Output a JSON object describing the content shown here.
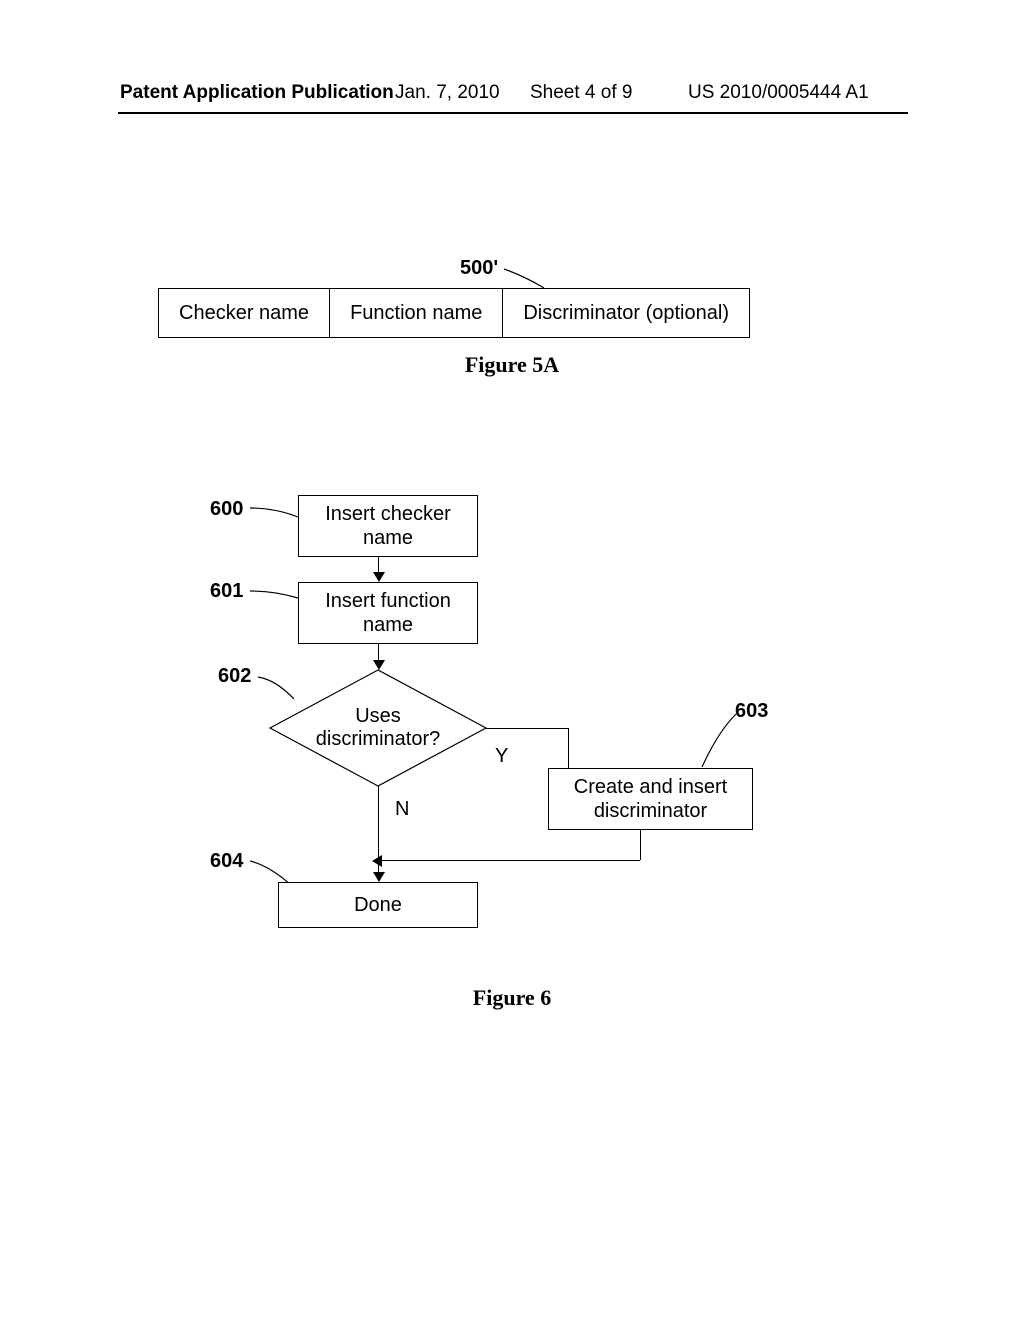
{
  "header": {
    "pub_type": "Patent Application Publication",
    "date": "Jan. 7, 2010",
    "sheet": "Sheet 4 of 9",
    "docnum": "US 2010/0005444 A1"
  },
  "fig5a": {
    "ref": "500'",
    "cells": [
      "Checker name",
      "Function name",
      "Discriminator (optional)"
    ],
    "caption": "Figure 5A"
  },
  "fig6": {
    "refs": {
      "b600": "600",
      "b601": "601",
      "b602": "602",
      "b603": "603",
      "b604": "604"
    },
    "box600": "Insert checker\nname",
    "box601": "Insert function\nname",
    "diamond602": "Uses\ndiscriminator?",
    "box603": "Create and insert\ndiscriminator",
    "box604": "Done",
    "y_label": "Y",
    "n_label": "N",
    "caption": "Figure 6"
  }
}
